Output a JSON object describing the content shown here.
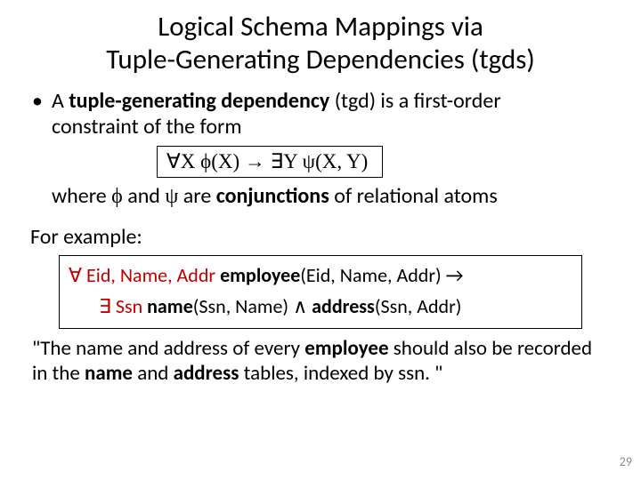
{
  "title_line1": "Logical Schema Mappings via",
  "title_line2": "Tuple-Generating Dependencies (tgds)",
  "bullet_pre": "A ",
  "bullet_bold": "tuple-generating dependency",
  "bullet_paren": " (tgd)",
  "bullet_rest1": " is a first-order",
  "bullet_rest2": "constraint of the form",
  "formula": "∀X ϕ(X) → ∃Y ψ(X, Y)",
  "where_pre": "where ",
  "phi": "ϕ",
  "where_mid": " and ",
  "psi": "ψ",
  "where_post1": " are ",
  "where_bold": "conjunctions",
  "where_post2": " of relational atoms",
  "for_example": "For example:",
  "ex_l1_q": "∀ Eid, Name, Addr  ",
  "ex_l1_b": "employee",
  "ex_l1_rest": "(Eid, Name, Addr) →",
  "ex_l2_q": "∃ Ssn ",
  "ex_l2_b1": "name",
  "ex_l2_mid": "(Ssn, Name) ∧ ",
  "ex_l2_b2": "address",
  "ex_l2_end": "(Ssn, Addr)",
  "quote_1": "\"The name and address of every ",
  "quote_b1": "employee",
  "quote_2": " should also be recorded in the ",
  "quote_b2": "name",
  "quote_3": " and ",
  "quote_b3": "address",
  "quote_4": " tables, indexed by ssn. \"",
  "page": "29"
}
